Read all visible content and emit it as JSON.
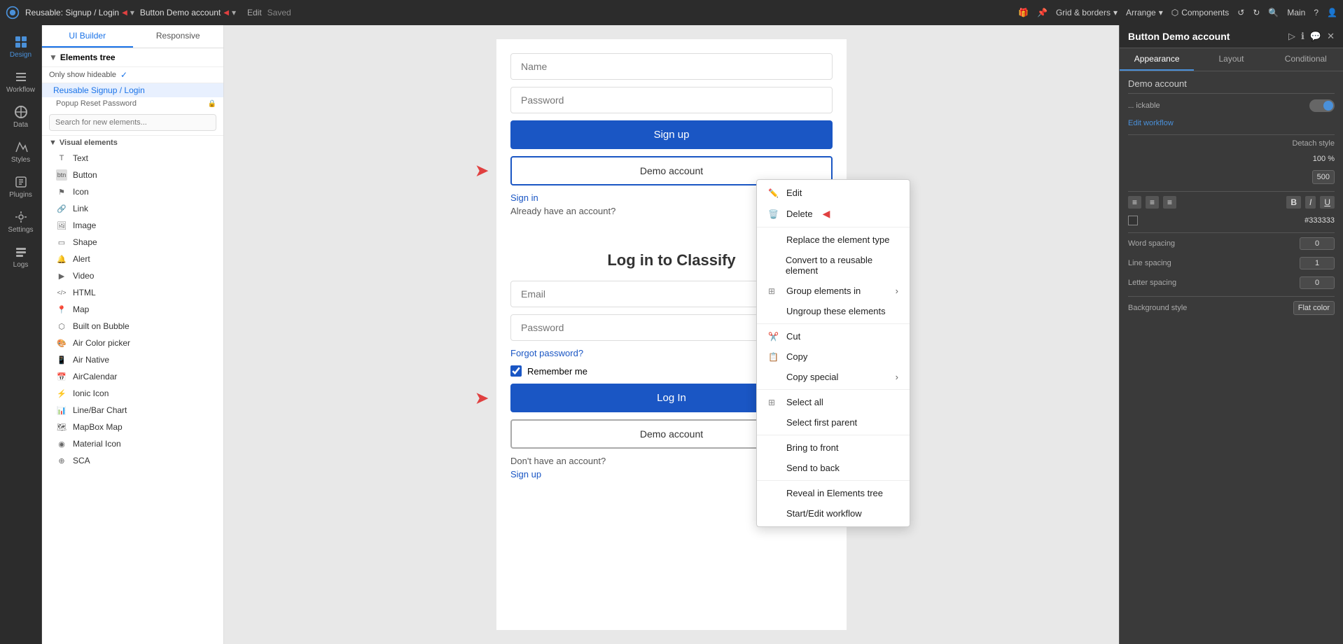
{
  "topbar": {
    "logo_alt": "Bubble logo",
    "reusable_label": "Reusable: Signup / Login",
    "button_demo_label": "Button Demo account",
    "edit_label": "Edit",
    "saved_label": "Saved",
    "grid_borders_label": "Grid & borders",
    "arrange_label": "Arrange",
    "components_label": "Components",
    "main_label": "Main"
  },
  "left_sidebar": {
    "items": [
      {
        "id": "design",
        "label": "Design",
        "icon": "grid"
      },
      {
        "id": "workflow",
        "label": "Workflow",
        "icon": "workflow"
      },
      {
        "id": "data",
        "label": "Data",
        "icon": "data"
      },
      {
        "id": "styles",
        "label": "Styles",
        "icon": "styles"
      },
      {
        "id": "plugins",
        "label": "Plugins",
        "icon": "plugins"
      },
      {
        "id": "settings",
        "label": "Settings",
        "icon": "settings"
      },
      {
        "id": "logs",
        "label": "Logs",
        "icon": "logs"
      }
    ]
  },
  "elements_panel": {
    "tab_ui_builder": "UI Builder",
    "tab_responsive": "Responsive",
    "tree_header": "Elements tree",
    "only_show_hideable": "Only show hideable",
    "tree_item_reusable": "Reusable Signup / Login",
    "tree_item_popup": "Popup Reset Password",
    "search_placeholder": "Search for new elements...",
    "visual_elements_header": "Visual elements",
    "elements": [
      {
        "icon": "T",
        "label": "Text"
      },
      {
        "icon": "btn",
        "label": "Button"
      },
      {
        "icon": "icon",
        "label": "Icon"
      },
      {
        "icon": "link",
        "label": "Link"
      },
      {
        "icon": "img",
        "label": "Image"
      },
      {
        "icon": "shape",
        "label": "Shape"
      },
      {
        "icon": "alert",
        "label": "Alert"
      },
      {
        "icon": "video",
        "label": "Video"
      },
      {
        "icon": "html",
        "label": "HTML"
      },
      {
        "icon": "map",
        "label": "Map"
      },
      {
        "icon": "bubble",
        "label": "Built on Bubble"
      },
      {
        "icon": "colorpicker",
        "label": "Air Color picker"
      },
      {
        "icon": "native",
        "label": "Air Native"
      },
      {
        "icon": "calendar",
        "label": "AirCalendar"
      },
      {
        "icon": "ionic",
        "label": "Ionic Icon"
      },
      {
        "icon": "chart",
        "label": "Line/Bar Chart"
      },
      {
        "icon": "mapbox",
        "label": "MapBox Map"
      },
      {
        "icon": "material",
        "label": "Material Icon"
      },
      {
        "icon": "sca",
        "label": "SCA"
      }
    ]
  },
  "canvas": {
    "name_placeholder": "Name",
    "password_placeholder": "Password",
    "signup_btn": "Sign up",
    "demo_account_btn": "Demo account",
    "sign_in_link": "Sign in",
    "already_have_account": "Already have an account?",
    "log_in_title": "Log in to Classify",
    "email_placeholder": "Email",
    "forgot_password": "Forgot password?",
    "remember_me": "Remember me",
    "log_in_btn": "Log In",
    "dont_have_account": "Don't have an account?",
    "sign_up_link": "Sign up"
  },
  "context_menu": {
    "items": [
      {
        "id": "edit",
        "label": "Edit",
        "icon": "pencil",
        "has_red_arrow": false
      },
      {
        "id": "delete",
        "label": "Delete",
        "icon": "trash",
        "has_red_arrow": true
      },
      {
        "id": "replace",
        "label": "Replace the element type",
        "icon": ""
      },
      {
        "id": "convert",
        "label": "Convert to a reusable element",
        "icon": ""
      },
      {
        "id": "group",
        "label": "Group elements in",
        "icon": "grid",
        "has_submenu": true
      },
      {
        "id": "ungroup",
        "label": "Ungroup these elements",
        "icon": ""
      },
      {
        "id": "cut",
        "label": "Cut",
        "icon": "scissors"
      },
      {
        "id": "copy",
        "label": "Copy",
        "icon": "copy"
      },
      {
        "id": "copy_special",
        "label": "Copy special",
        "icon": "",
        "has_submenu": true
      },
      {
        "id": "select_all",
        "label": "Select all",
        "icon": "grid"
      },
      {
        "id": "select_first_parent",
        "label": "Select first parent",
        "icon": ""
      },
      {
        "id": "bring_to_front",
        "label": "Bring to front",
        "icon": ""
      },
      {
        "id": "send_to_back",
        "label": "Send to back",
        "icon": ""
      },
      {
        "id": "reveal",
        "label": "Reveal in Elements tree",
        "icon": ""
      },
      {
        "id": "start_edit_workflow",
        "label": "Start/Edit workflow",
        "icon": ""
      }
    ]
  },
  "right_panel": {
    "title": "Button Demo account",
    "tab_appearance": "Appearance",
    "tab_layout": "Layout",
    "tab_conditional": "Conditional",
    "element_name": "Demo account",
    "clickable_label": "ickable",
    "edit_workflow_label": "Edit workflow",
    "detach_style_label": "Detach style",
    "opacity_value": "100 %",
    "width_value": "500",
    "align_options": [
      "left",
      "center",
      "right"
    ],
    "bold_label": "B",
    "italic_label": "I",
    "underline_label": "U",
    "color_hex": "#333333",
    "word_spacing_label": "Word spacing",
    "line_spacing_label": "Line spacing",
    "letter_spacing_label": "Letter spacing",
    "word_spacing_value": "0",
    "line_spacing_value": "1",
    "letter_spacing_value": "0",
    "background_style_label": "Background style",
    "flat_color_label": "Flat color"
  }
}
